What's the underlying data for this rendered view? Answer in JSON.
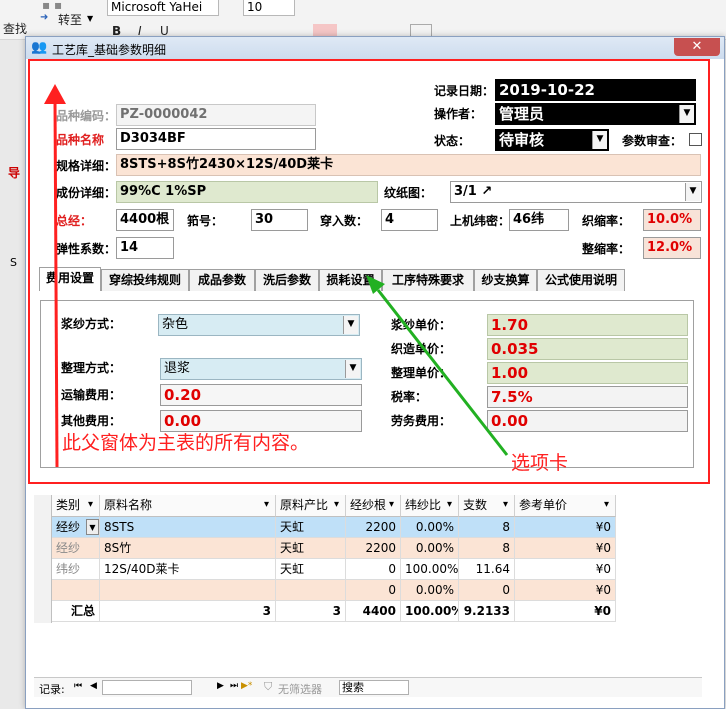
{
  "ribbon": {
    "find_label": "查找",
    "goto_label": "转至",
    "font_name": "Microsoft YaHei",
    "font_size": "10",
    "bold": "B",
    "italic": "I",
    "underline": "U",
    "nav_prefix": "导",
    "s_button": "S"
  },
  "window": {
    "title": "工艺库_基础参数明细",
    "close": "✕"
  },
  "header_fields": {
    "record_date_label": "记录日期：",
    "record_date": "2019-10-22",
    "operator_label": "操作者：",
    "operator": "管理员",
    "status_label": "状态：",
    "status": "待审核",
    "param_review_label": "参数审查：",
    "variety_code_label": "品种编码：",
    "variety_code": "PZ-0000042",
    "variety_name_label": "品种名称",
    "variety_name": "D3034BF",
    "spec_label": "规格详细：",
    "spec": "8STS+8S竹2430×12S/40D莱卡",
    "composition_label": "成份详细：",
    "composition": "99%C 1%SP",
    "weave_label": "纹纸图：",
    "weave": "3/1 ↗",
    "total_warp_label": "总经：",
    "total_warp": "4400根",
    "reed_label": "筘号：",
    "reed": "30",
    "threading_label": "穿入数：",
    "threading": "4",
    "loom_weft_label": "上机纬密：",
    "loom_weft": "46纬",
    "weave_shrink_label": "织缩率：",
    "weave_shrink": "10.0%",
    "elastic_label": "弹性系数：",
    "elastic": "14",
    "finish_shrink_label": "整缩率：",
    "finish_shrink": "12.0%"
  },
  "tabs": [
    {
      "label": "费用设置"
    },
    {
      "label": "穿综投纬规则"
    },
    {
      "label": "成品参数"
    },
    {
      "label": "洗后参数"
    },
    {
      "label": "损耗设置"
    },
    {
      "label": "工序特殊要求"
    },
    {
      "label": "纱支换算"
    },
    {
      "label": "公式使用说明"
    }
  ],
  "cost": {
    "sizing_method_label": "浆纱方式：",
    "sizing_method": "杂色",
    "finish_method_label": "整理方式：",
    "finish_method": "退浆",
    "transport_label": "运输费用：",
    "transport": "0.20",
    "other_label": "其他费用：",
    "other": "0.00",
    "sizing_price_label": "浆纱单价：",
    "sizing_price": "1.70",
    "weaving_price_label": "织造单价：",
    "weaving_price": "0.035",
    "finish_price_label": "整理单价：",
    "finish_price": "1.00",
    "tax_label": "税率：",
    "tax": "7.5%",
    "labor_label": "劳务费用：",
    "labor": "0.00"
  },
  "annotations": {
    "parent_note": "此父窗体为主表的所有内容。",
    "tab_note": "选项卡"
  },
  "grid": {
    "headers": [
      "类别",
      "原料名称",
      "原料产比",
      "经纱根",
      "纬纱比",
      "支数",
      "参考单价"
    ],
    "rows": [
      {
        "cat": "经纱",
        "name": "8STS",
        "origin": "天虹",
        "warp": "2200",
        "weft": "0.00%",
        "count": "8",
        "price": "¥0"
      },
      {
        "cat": "经纱",
        "name": "8S竹",
        "origin": "天虹",
        "warp": "2200",
        "weft": "0.00%",
        "count": "8",
        "price": "¥0"
      },
      {
        "cat": "纬纱",
        "name": "12S/40D莱卡",
        "origin": "天虹",
        "warp": "0",
        "weft": "100.00%",
        "count": "11.64",
        "price": "¥0"
      },
      {
        "cat": "",
        "name": "",
        "origin": "",
        "warp": "0",
        "weft": "0.00%",
        "count": "0",
        "price": "¥0"
      }
    ],
    "new_marker": "*",
    "total": {
      "label": "汇总",
      "name": "3",
      "origin": "3",
      "warp": "4400",
      "weft": "100.00%",
      "count": "9.2133",
      "price": "¥0"
    }
  },
  "nav": {
    "record_label": "记录:",
    "first": "⏮",
    "prev": "◀",
    "next": "▶",
    "last": "⏭",
    "new": "▶*",
    "no_filter": "无筛选器",
    "search": "搜索"
  },
  "colors": {
    "annotation_red": "#ff2020",
    "annotation_green": "#22b022",
    "value_red": "#e00000"
  }
}
